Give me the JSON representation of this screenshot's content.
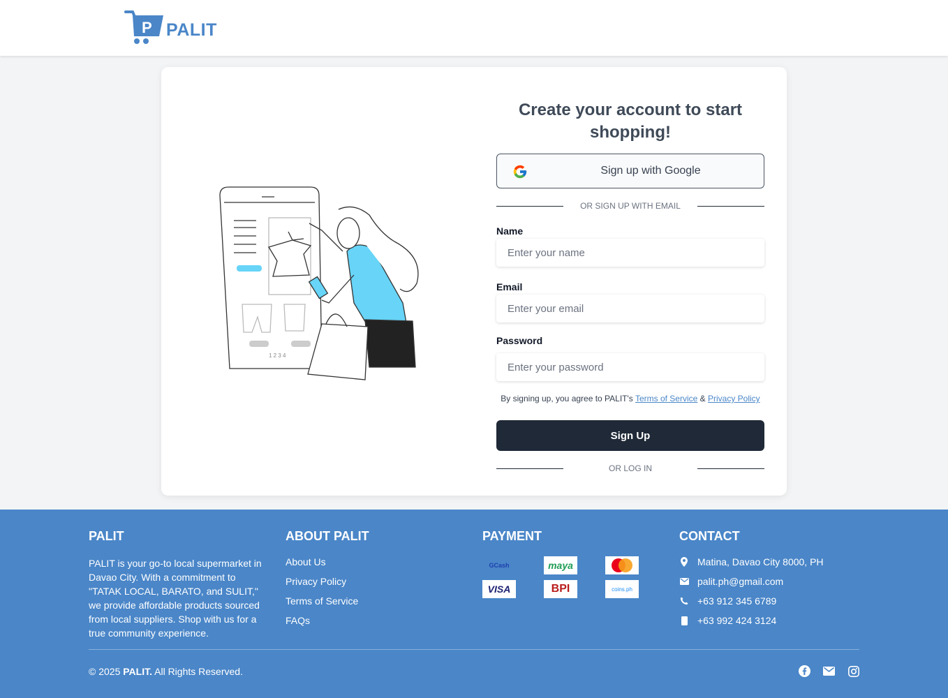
{
  "header": {
    "brand": "PALIT"
  },
  "form": {
    "title": "Create your account to start shopping!",
    "google_button": "Sign up with Google",
    "or_email": "OR SIGN UP WITH EMAIL",
    "name_label": "Name",
    "name_placeholder": "Enter your name",
    "email_label": "Email",
    "email_placeholder": "Enter your email",
    "password_label": "Password",
    "password_placeholder": "Enter your password",
    "terms_prefix": "By signing up, you agree to PALIT's",
    "terms_link": "Terms of Service",
    "terms_and": "&",
    "privacy_link": "Privacy Policy",
    "signup_button": "Sign Up",
    "or_login": "OR LOG IN"
  },
  "footer": {
    "palit_heading": "PALIT",
    "palit_desc": "PALIT is your go-to local supermarket in Davao City. With a commitment to \"TATAK LOCAL, BARATO, and SULIT,\" we provide affordable products sourced from local suppliers. Shop with us for a true community experience.",
    "about_heading": "ABOUT PALIT",
    "about_links": [
      "About Us",
      "Privacy Policy",
      "Terms of Service",
      "FAQs"
    ],
    "payment_heading": "PAYMENT",
    "payments": [
      "GCash",
      "maya",
      "mastercard",
      "VISA",
      "BPI",
      "coins.ph"
    ],
    "contact_heading": "CONTACT",
    "contact": {
      "address": "Matina, Davao City 8000, PH",
      "email": "palit.ph@gmail.com",
      "phone": "+63 912 345 6789",
      "mobile": "+63 992 424 3124"
    },
    "copyright_prefix": "© 2025",
    "copyright_brand": "PALIT.",
    "copyright_suffix": "All Rights Reserved."
  },
  "colors": {
    "brand": "#4a86c8",
    "dark_button": "#1f2937",
    "illustration_accent": "#67d4f8"
  }
}
